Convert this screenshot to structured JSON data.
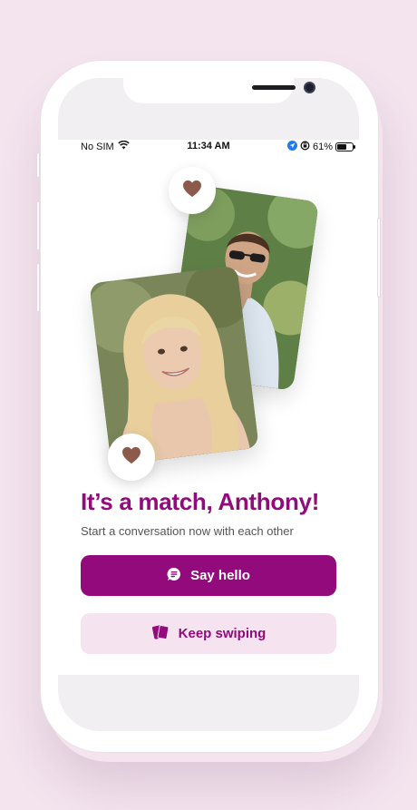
{
  "status_bar": {
    "carrier": "No SIM",
    "time": "11:34 AM",
    "battery_percent": "61%",
    "battery_level": 0.61
  },
  "match": {
    "title": "It’s a match, Anthony!",
    "subtitle": "Start a conversation now with each other"
  },
  "actions": {
    "say_hello_label": "Say hello",
    "keep_swiping_label": "Keep swiping"
  },
  "colors": {
    "brand": "#930a7c",
    "brand_light": "#f5e4ef",
    "heart": "#8b5a4a",
    "background": "#f3e4ee"
  },
  "icons": [
    "wifi-icon",
    "location-arrow-icon",
    "rotation-lock-icon",
    "battery-icon",
    "heart-icon",
    "chat-bubble-icon",
    "cards-icon"
  ]
}
